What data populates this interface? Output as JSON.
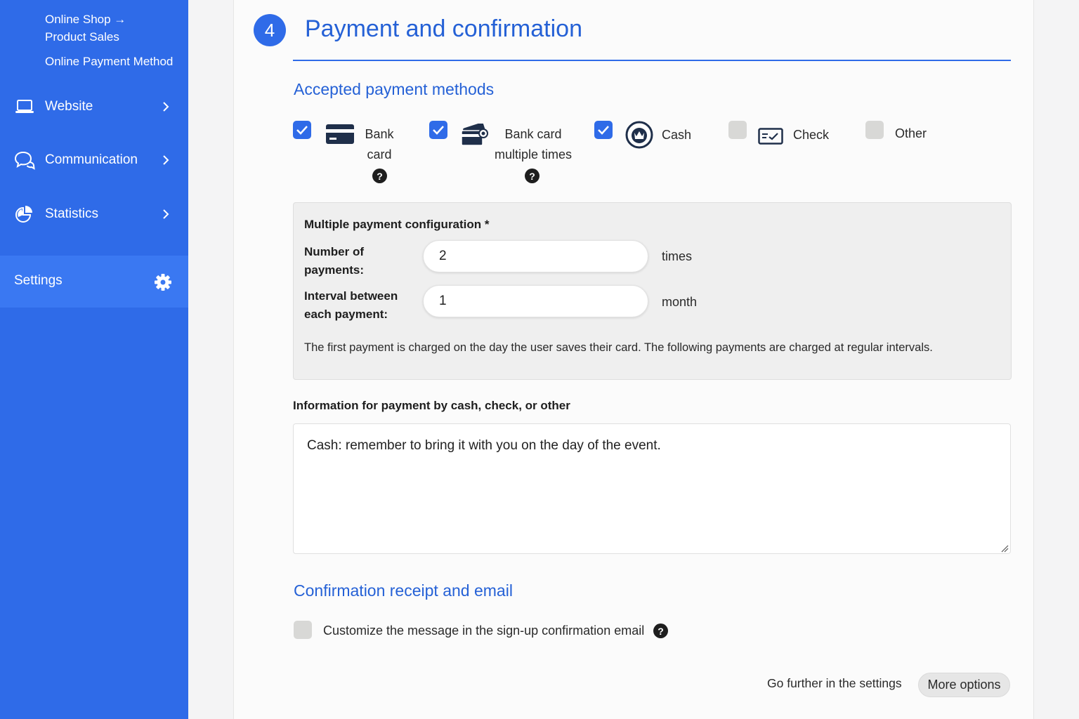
{
  "sidebar": {
    "sub_links": [
      "Online Shop →",
      "Product Sales",
      "Online Payment Method"
    ],
    "items": [
      {
        "label": "Website",
        "icon": "laptop-icon"
      },
      {
        "label": "Communication",
        "icon": "chat-bubbles-icon"
      },
      {
        "label": "Statistics",
        "icon": "pie-chart-icon"
      }
    ],
    "settings": {
      "label": "Settings",
      "icon": "gear-icon"
    }
  },
  "main": {
    "step_number": "4",
    "title": "Payment and confirmation",
    "accepted_heading": "Accepted payment methods",
    "payment_methods": [
      {
        "line1": "Bank",
        "line2": "card",
        "checked": true,
        "icon": "credit-card-icon",
        "help": "?"
      },
      {
        "line1": "Bank card",
        "line2": "multiple times",
        "checked": true,
        "icon": "cards-multiple-icon",
        "help": "?"
      },
      {
        "line1": "Cash",
        "checked": true,
        "icon": "coin-icon"
      },
      {
        "line1": "Check",
        "checked": false,
        "icon": "check-icon"
      },
      {
        "line1": "Other",
        "checked": false
      }
    ],
    "multi_config": {
      "title": "Multiple payment configuration *",
      "num_payments_label_1": "Number of",
      "num_payments_label_2": "payments:",
      "num_payments_value": "2",
      "num_payments_unit": "times",
      "interval_label_1": "Interval between",
      "interval_label_2": "each payment:",
      "interval_value": "1",
      "interval_unit": "month",
      "note": "The first payment is charged on the day the user saves their card. The following payments are charged at regular intervals."
    },
    "info_label": "Information for payment by cash, check, or other",
    "info_text": "Cash: remember to bring it with you on the day of the event.",
    "confirmation_heading": "Confirmation receipt and email",
    "customize_label": "Customize the message in the sign-up confirmation email",
    "customize_checked": false,
    "help_glyph": "?",
    "further_text": "Go further in the settings",
    "more_options": "More options"
  },
  "colors": {
    "accent": "#2f6be8",
    "heading": "#2561d6",
    "sidebar": "#2f6be8"
  }
}
